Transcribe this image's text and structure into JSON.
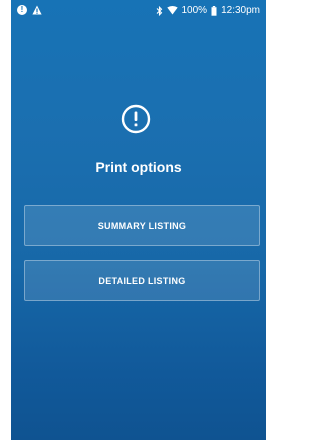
{
  "status_bar": {
    "left_icons": [
      "info-icon",
      "warning-icon"
    ],
    "right_icons": [
      "bluetooth-icon",
      "wifi-icon",
      "battery-icon"
    ],
    "battery_percent": "100%",
    "time": "12:30pm"
  },
  "dialog": {
    "icon": "exclamation-circle-icon",
    "title": "Print options",
    "buttons": [
      {
        "label": "SUMMARY LISTING"
      },
      {
        "label": "DETAILED LISTING"
      }
    ]
  },
  "colors": {
    "background_top": "#1773b6",
    "background_bottom": "#0f5391",
    "text": "#ffffff"
  }
}
